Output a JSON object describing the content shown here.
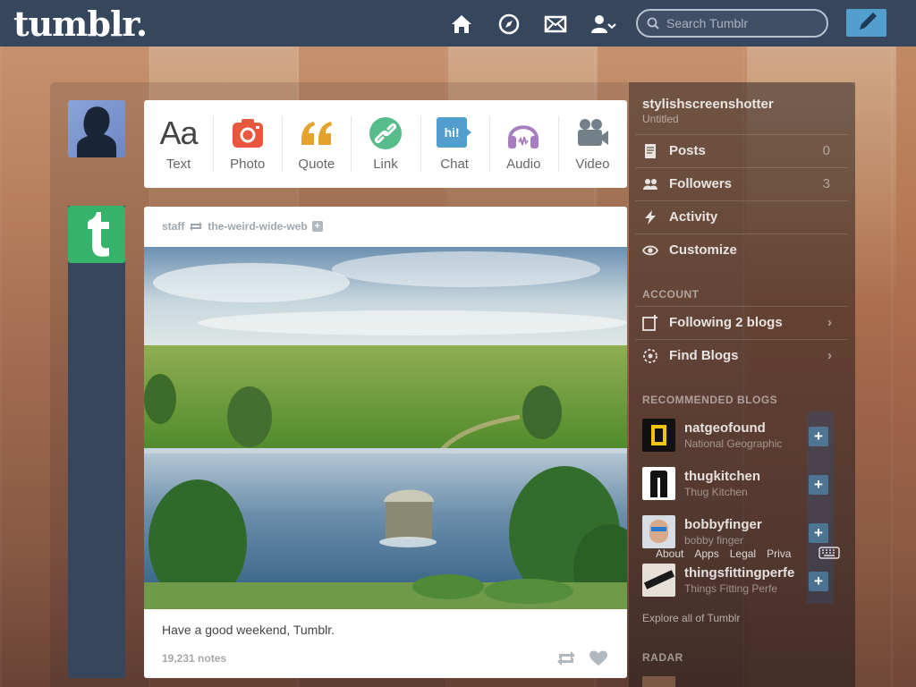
{
  "app": {
    "logo": "tumblr."
  },
  "search": {
    "placeholder": "Search Tumblr"
  },
  "post_types": [
    {
      "label": "Text"
    },
    {
      "label": "Photo"
    },
    {
      "label": "Quote"
    },
    {
      "label": "Link"
    },
    {
      "label": "Chat"
    },
    {
      "label": "Audio"
    },
    {
      "label": "Video"
    }
  ],
  "post_type_icons": {
    "text": "Aa",
    "chat": "hi!"
  },
  "post": {
    "author": "staff",
    "reblogged_from": "the-weird-wide-web",
    "caption": "Have a good weekend, Tumblr.",
    "notes": "19,231 notes"
  },
  "sidebar": {
    "blog_name": "stylishscreenshotter",
    "blog_subtitle": "Untitled",
    "items": [
      {
        "label": "Posts",
        "count": "0"
      },
      {
        "label": "Followers",
        "count": "3"
      },
      {
        "label": "Activity",
        "count": ""
      },
      {
        "label": "Customize",
        "count": ""
      }
    ],
    "account_heading": "ACCOUNT",
    "account_items": [
      {
        "label": "Following 2 blogs"
      },
      {
        "label": "Find Blogs"
      }
    ],
    "recommended_heading": "RECOMMENDED BLOGS",
    "recommended": [
      {
        "name": "natgeofound",
        "title": "National Geographic"
      },
      {
        "name": "thugkitchen",
        "title": "Thug Kitchen"
      },
      {
        "name": "bobbyfinger",
        "title": "bobby finger"
      },
      {
        "name": "thingsfittingperfe",
        "title": "Things Fitting Perfe"
      }
    ],
    "footer_links": [
      "About",
      "Apps",
      "Legal",
      "Priva"
    ],
    "explore_link": "Explore all of Tumblr",
    "radar_heading": "RADAR"
  },
  "colors": {
    "topbar": "#36465d",
    "compose": "#529ecc",
    "photo": "#e8583f",
    "quote": "#e5a22c",
    "link": "#56bc8a",
    "chat": "#529ecc",
    "audio": "#a77dc2",
    "video": "#748089",
    "staff_green": "#36b36a"
  }
}
